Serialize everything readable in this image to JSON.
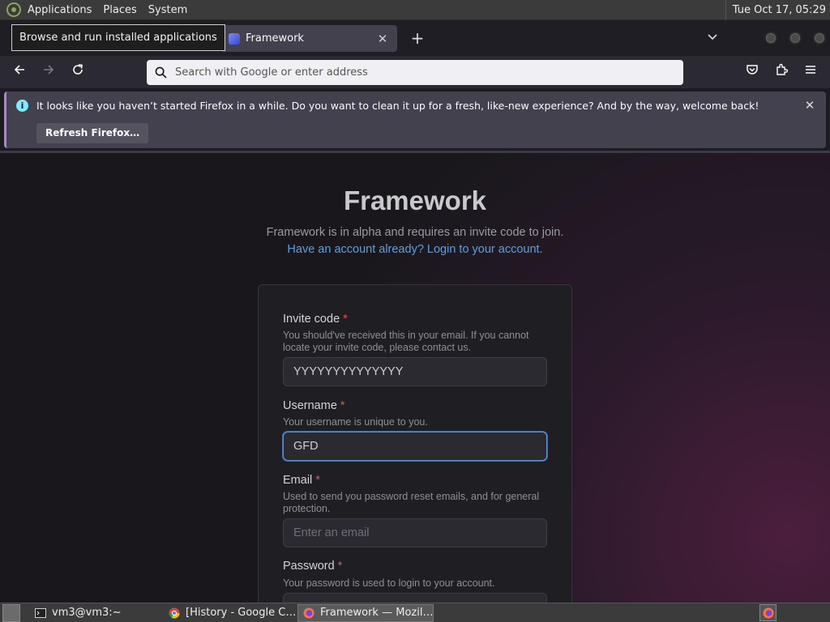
{
  "panel": {
    "menus": [
      "Applications",
      "Places",
      "System"
    ],
    "clock": "Tue Oct 17, 05:29",
    "tooltip": "Browse and run installed applications"
  },
  "browser": {
    "tab_title": "Framework",
    "url_placeholder": "Search with Google or enter address",
    "notification": {
      "message": "It looks like you haven’t started Firefox in a while. Do you want to clean it up for a fresh, like-new experience? And by the way, welcome back!",
      "button": "Refresh Firefox…"
    }
  },
  "page": {
    "title": "Framework",
    "subtitle": "Framework is in alpha and requires an invite code to join.",
    "login_link": "Have an account already? Login to your account.",
    "form": {
      "invite": {
        "label": "Invite code",
        "required": "*",
        "help": "You should've received this in your email. If you cannot locate your invite code, please contact us.",
        "value": "YYYYYYYYYYYYYY"
      },
      "username": {
        "label": "Username",
        "required": "*",
        "help": "Your username is unique to you.",
        "value": "GFD"
      },
      "email": {
        "label": "Email",
        "required": "*",
        "help": "Used to send you password reset emails, and for general protection.",
        "placeholder": "Enter an email"
      },
      "password": {
        "label": "Password",
        "required": "*",
        "help": "Your password is used to login to your account."
      }
    }
  },
  "taskbar": {
    "items": [
      "vm3@vm3:~",
      "[History - Google C…",
      "Framework — Mozil…"
    ]
  },
  "colors": {
    "accent_link": "#5aa0e0",
    "required": "#e05252",
    "focus_border": "#5f8ed4",
    "notification_stripe": "#b67dd1"
  }
}
